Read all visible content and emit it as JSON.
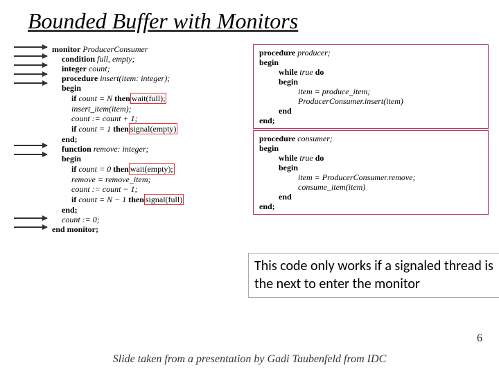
{
  "title": "Bounded Buffer with Monitors",
  "left_code": {
    "l1a": "monitor",
    "l1b": " ProducerConsumer",
    "l2a": "condition",
    "l2b": " full, empty;",
    "l3a": "integer",
    "l3b": " count;",
    "l4a": "procedure",
    "l4b": " insert(item: integer);",
    "l5": "begin",
    "l6a": "if",
    "l6b": " count = N ",
    "l6c": "then",
    "l6d": " wait(full);",
    "l7": "insert_item(item);",
    "l8": "count := count + 1;",
    "l9a": "if",
    "l9b": " count = 1 ",
    "l9c": "then",
    "l9d": " signal(empty)",
    "l10": "end;",
    "l11a": "function",
    "l11b": " remove: integer;",
    "l12": "begin",
    "l13a": "if",
    "l13b": " count = 0 ",
    "l13c": "then",
    "l13d": " wait(empty);",
    "l14": "remove = remove_item;",
    "l15": "count := count − 1;",
    "l16a": "if",
    "l16b": " count = N − 1 ",
    "l16c": "then",
    "l16d": " signal(full)",
    "l17": "end;",
    "l18": "count := 0;",
    "l19": "end monitor;"
  },
  "right_code_top": {
    "l1a": "procedure",
    "l1b": " producer;",
    "l2": "begin",
    "l3a": "while",
    "l3b": " true ",
    "l3c": "do",
    "l4": "begin",
    "l5": "item = produce_item;",
    "l6": "ProducerConsumer.insert(item)",
    "l7": "end",
    "l8": "end;"
  },
  "right_code_bottom": {
    "l1a": "procedure",
    "l1b": " consumer;",
    "l2": "begin",
    "l3a": "while",
    "l3b": " true ",
    "l3c": "do",
    "l4": "begin",
    "l5": "item = ProducerConsumer.remove;",
    "l6": "consume_item(item)",
    "l7": "end",
    "l8": "end;"
  },
  "note": "This code only works if a signaled thread is the next to enter the monitor",
  "footer": "Slide taken from a presentation by Gadi Taubenfeld from IDC",
  "page": "6"
}
